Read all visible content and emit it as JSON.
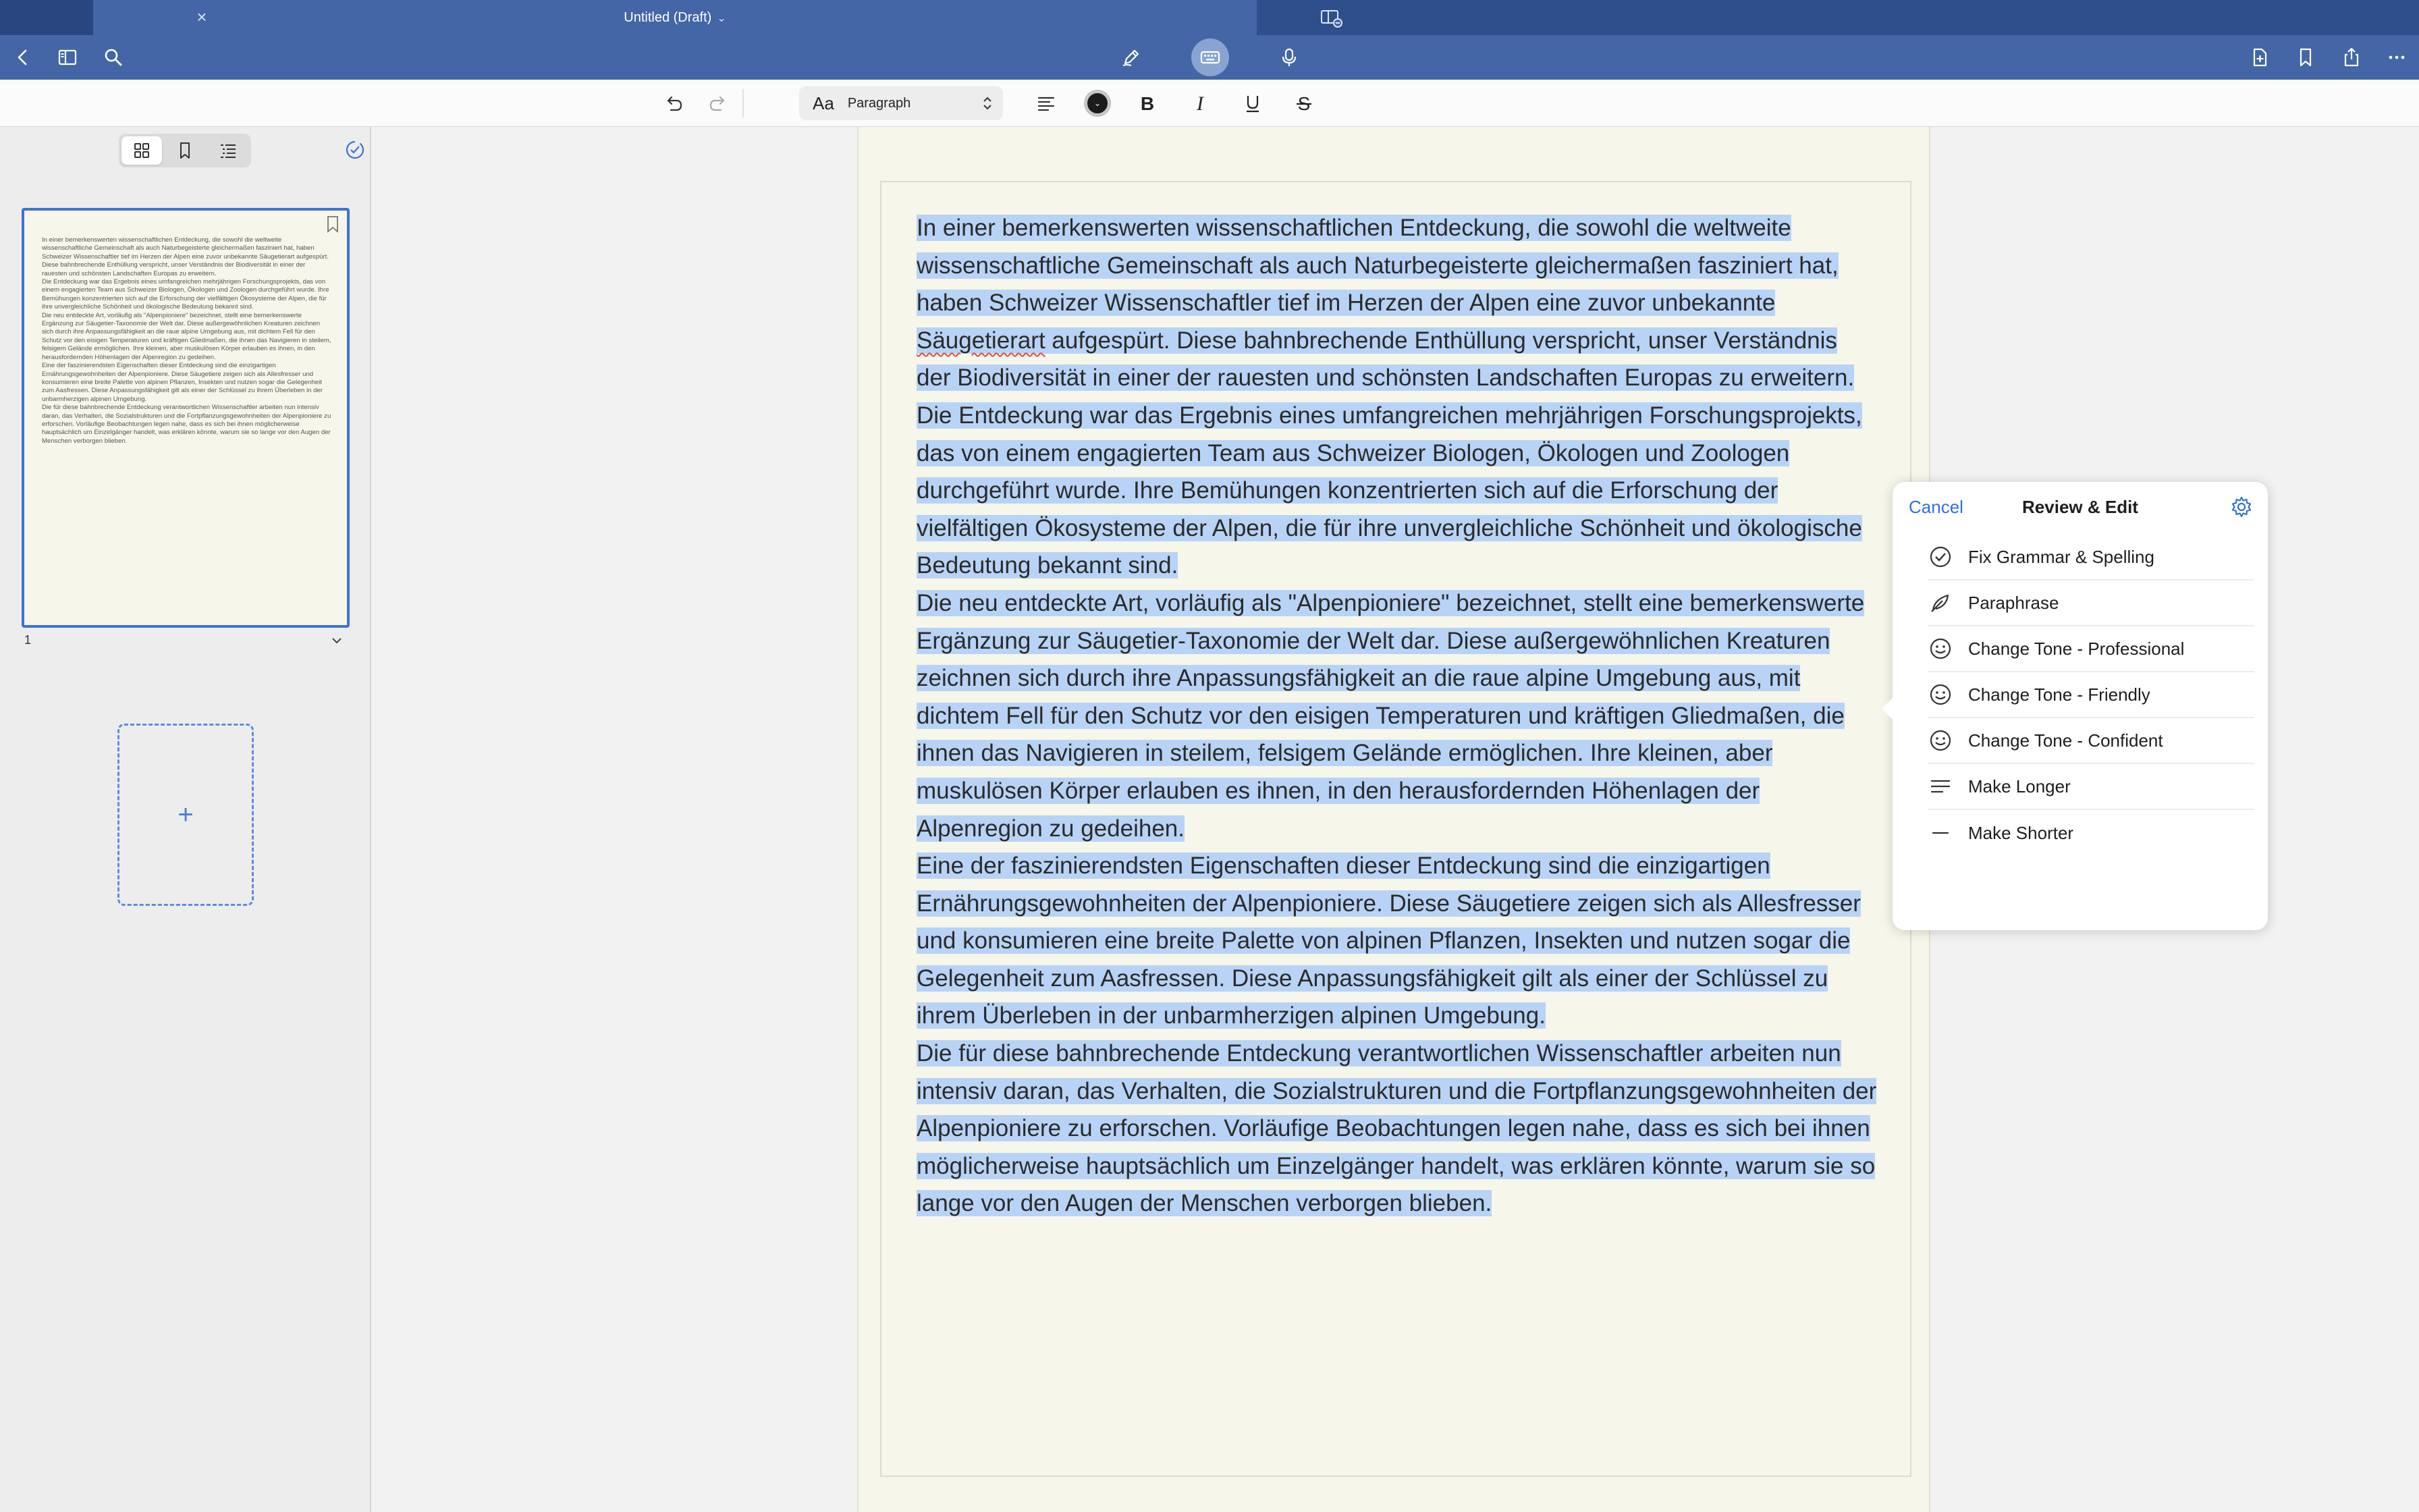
{
  "tab": {
    "title": "Untitled (Draft)"
  },
  "toolbar": {
    "paragraph_style": "Paragraph",
    "aa_label": "Aa"
  },
  "sidebar": {
    "page_number": "1",
    "add_symbol": "+"
  },
  "document": {
    "paragraphs": [
      "In einer bemerkenswerten wissenschaftlichen Entdeckung, die sowohl die weltweite wissenschaftliche Gemeinschaft als auch Naturbegeisterte gleichermaßen fasziniert hat, haben Schweizer Wissenschaftler tief im Herzen der Alpen eine zuvor unbekannte Säugetierart aufgespürt. Diese bahnbrechende Enthüllung verspricht, unser Verständnis der Biodiversität in einer der rauesten und schönsten Landschaften Europas zu erweitern.",
      "Die Entdeckung war das Ergebnis eines umfangreichen mehrjährigen Forschungsprojekts, das von einem engagierten Team aus Schweizer Biologen, Ökologen und Zoologen durchgeführt wurde. Ihre Bemühungen konzentrierten sich auf die Erforschung der vielfältigen Ökosysteme der Alpen, die für ihre unvergleichliche Schönheit und ökologische Bedeutung bekannt sind.",
      "Die neu entdeckte Art, vorläufig als \"Alpenpioniere\" bezeichnet, stellt eine bemerkenswerte Ergänzung zur Säugetier-Taxonomie der Welt dar. Diese außergewöhnlichen Kreaturen zeichnen sich durch ihre Anpassungsfähigkeit an die raue alpine Umgebung aus, mit dichtem Fell für den Schutz vor den eisigen Temperaturen und kräftigen Gliedmaßen, die ihnen das Navigieren in steilem, felsigem Gelände ermöglichen. Ihre kleinen, aber muskulösen Körper erlauben es ihnen, in den herausfordernden Höhenlagen der Alpenregion zu gedeihen.",
      "Eine der faszinierendsten Eigenschaften dieser Entdeckung sind die einzigartigen Ernährungsgewohnheiten der Alpenpioniere. Diese Säugetiere zeigen sich als Allesfresser und konsumieren eine breite Palette von alpinen Pflanzen, Insekten und nutzen sogar die Gelegenheit zum Aasfressen. Diese Anpassungsfähigkeit gilt als einer der Schlüssel zu ihrem Überleben in der unbarmherzigen alpinen Umgebung.",
      "Die für diese bahnbrechende Entdeckung verantwortlichen Wissenschaftler arbeiten nun intensiv daran, das Verhalten, die Sozialstrukturen und die Fortpflanzungsgewohnheiten der Alpenpioniere zu erforschen. Vorläufige Beobachtungen legen nahe, dass es sich bei ihnen möglicherweise hauptsächlich um Einzelgänger handelt, was erklären könnte, warum sie so lange vor den Augen der Menschen verborgen blieben."
    ]
  },
  "popover": {
    "cancel": "Cancel",
    "title": "Review & Edit",
    "items": [
      {
        "label": "Fix Grammar & Spelling",
        "icon": "check-circle-icon"
      },
      {
        "label": "Paraphrase",
        "icon": "feather-icon"
      },
      {
        "label": "Change Tone - Professional",
        "icon": "smiley-icon"
      },
      {
        "label": "Change Tone - Friendly",
        "icon": "smiley-icon"
      },
      {
        "label": "Change Tone - Confident",
        "icon": "smiley-icon"
      },
      {
        "label": "Make Longer",
        "icon": "lines-icon"
      },
      {
        "label": "Make Shorter",
        "icon": "dash-icon"
      }
    ]
  },
  "colors": {
    "navbar": "#4466a6",
    "accent": "#2f6fdc",
    "selection": "#b8d3f5",
    "page": "#f7f6ea"
  }
}
